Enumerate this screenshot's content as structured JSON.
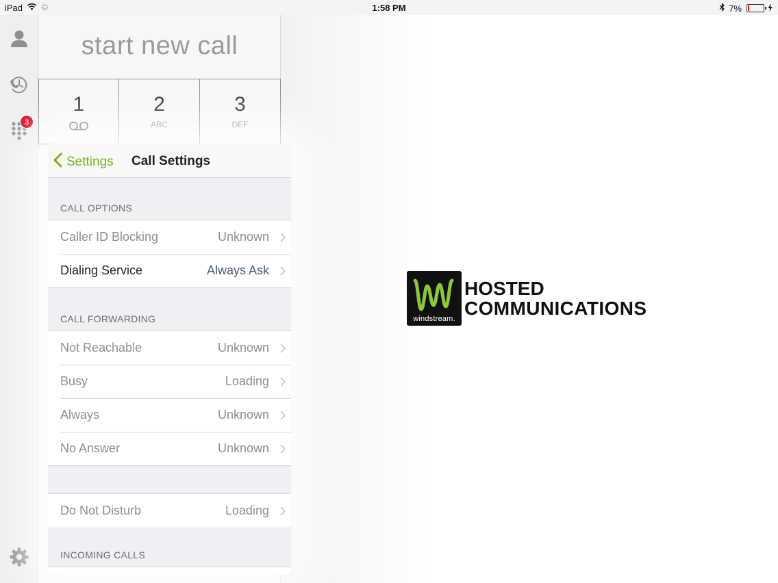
{
  "status_bar": {
    "device": "iPad",
    "time": "1:58 PM",
    "battery": "7%"
  },
  "rail": {
    "contacts_icon": "person-icon",
    "recents_icon": "clock-phone-icon",
    "keypad_icon": "keypad-icon",
    "keypad_badge": "3",
    "settings_icon": "gear-icon"
  },
  "dialer": {
    "title": "start new call",
    "keys": [
      {
        "digit": "1",
        "letters": ""
      },
      {
        "digit": "2",
        "letters": "ABC"
      },
      {
        "digit": "3",
        "letters": "DEF"
      }
    ]
  },
  "settings_panel": {
    "back_label": "Settings",
    "title": "Call Settings",
    "sections": {
      "call_options": {
        "header": "CALL OPTIONS",
        "rows": [
          {
            "label": "Caller ID Blocking",
            "value": "Unknown"
          },
          {
            "label": "Dialing Service",
            "value": "Always Ask"
          }
        ]
      },
      "call_forwarding": {
        "header": "CALL FORWARDING",
        "rows": [
          {
            "label": "Not Reachable",
            "value": "Unknown"
          },
          {
            "label": "Busy",
            "value": "Loading"
          },
          {
            "label": "Always",
            "value": "Unknown"
          },
          {
            "label": "No Answer",
            "value": "Unknown"
          }
        ]
      },
      "dnd": {
        "rows": [
          {
            "label": "Do Not Disturb",
            "value": "Loading"
          }
        ]
      },
      "incoming_calls": {
        "header": "INCOMING CALLS"
      }
    }
  },
  "brand": {
    "logo_word": "windstream.",
    "line1": "HOSTED",
    "line2": "COMMUNICATIONS"
  },
  "colors": {
    "accent_green": "#7ab317",
    "badge_red": "#d0021b",
    "value_blue": "#4a5a78"
  }
}
